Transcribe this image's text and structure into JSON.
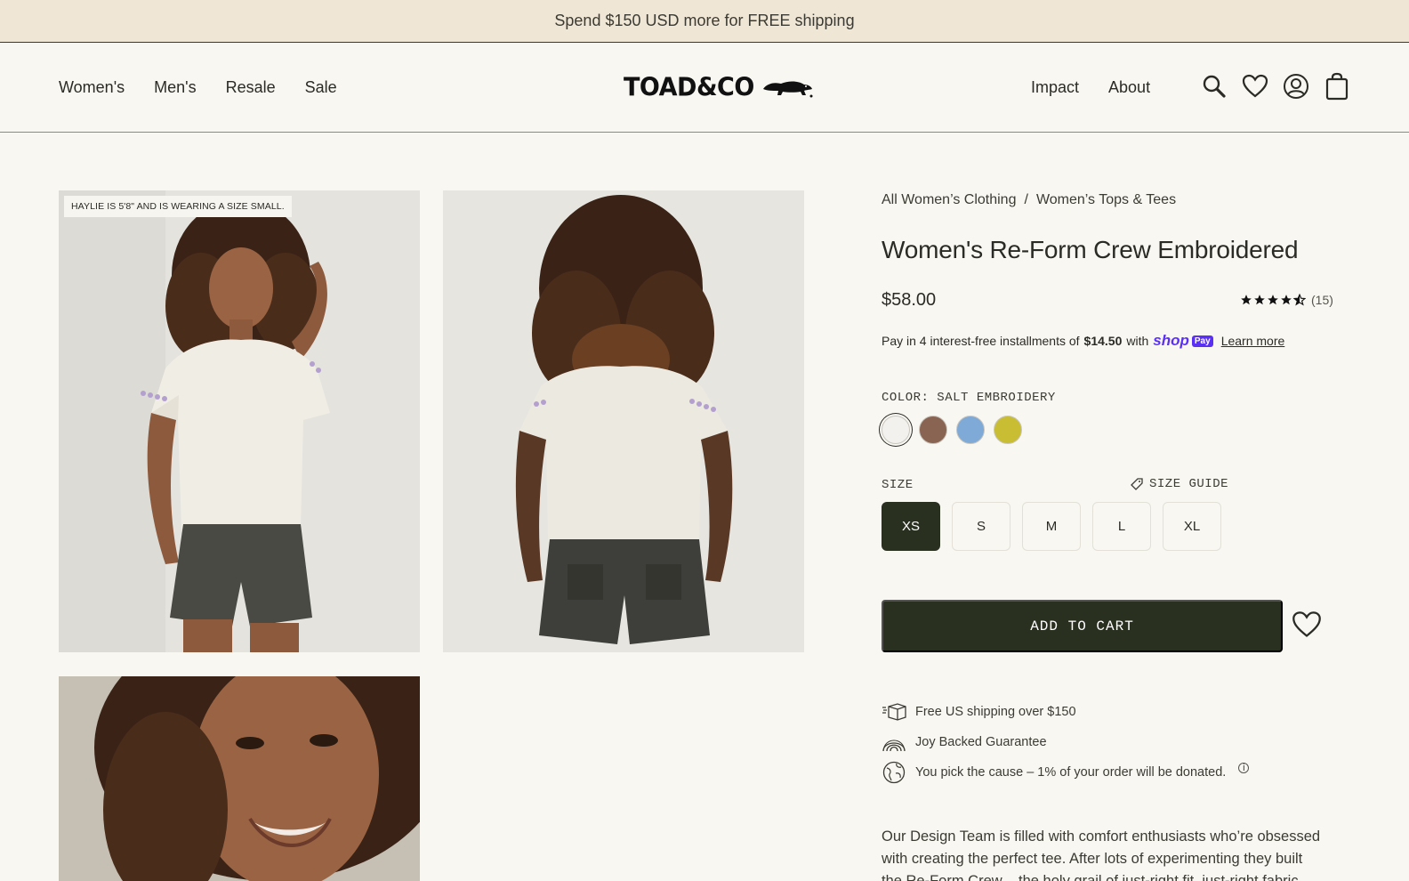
{
  "announcement": "Spend $150 USD more for FREE shipping",
  "nav": {
    "left": [
      "Women's",
      "Men's",
      "Resale",
      "Sale"
    ],
    "right": [
      "Impact",
      "About"
    ],
    "logo_text": "TOAD&CO"
  },
  "header_icons": [
    "search-icon",
    "heart-icon",
    "account-icon",
    "cart-bag-icon"
  ],
  "gallery": {
    "model_note": "HAYLIE IS 5'8\" AND IS WEARING A SIZE SMALL."
  },
  "product": {
    "breadcrumb": [
      "All Women’s Clothing",
      "/",
      "Women’s Tops & Tees"
    ],
    "title": "Women's Re-Form Crew Embroidered",
    "price": "$58.00",
    "rating": 4.5,
    "review_count": "(15)",
    "shoppay": {
      "prefix": "Pay in 4 interest-free installments of",
      "amount": "$14.50",
      "suffix": "with",
      "brand": "shop",
      "badge": "Pay",
      "learn_more": "Learn more"
    },
    "color_label": "COLOR: SALT EMBROIDERY",
    "swatch_colors": [
      "#f3f1ee",
      "#8a6452",
      "#7fa9d6",
      "#c9bd33"
    ],
    "size_label": "SIZE",
    "size_guide": "SIZE GUIDE",
    "sizes": [
      "XS",
      "S",
      "M",
      "L",
      "XL"
    ],
    "selected_size": "XS",
    "add_to_cart": "ADD TO CART",
    "perks": [
      "Free US shipping over $150",
      "Joy Backed Guarantee",
      "You pick the cause – 1% of your order will be donated."
    ],
    "description": "Our Design Team is filled with comfort enthusiasts who’re obsessed with creating the perfect tee. After lots of experimenting they built the Re-Form Crew – the holy grail of just-right fit, just-right fabric."
  },
  "colors": {
    "announcement_bg": "#efe6d6",
    "page_bg": "#f9f7f2",
    "dark_green": "#2a3020",
    "shop_pay": "#5a31f4"
  }
}
